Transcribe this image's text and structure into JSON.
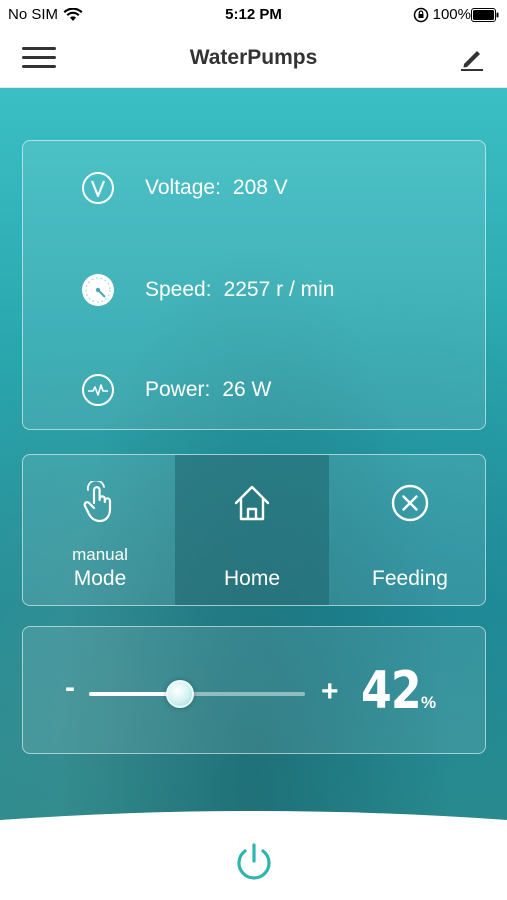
{
  "status_bar": {
    "carrier": "No SIM",
    "time": "5:12 PM",
    "battery": "100%"
  },
  "navbar": {
    "title": "WaterPumps",
    "menu_icon": "hamburger-menu-icon",
    "edit_icon": "pencil-icon"
  },
  "stats": [
    {
      "icon": "voltage-icon",
      "label": "Voltage:",
      "value": "208 V"
    },
    {
      "icon": "speedometer-icon",
      "label": "Speed:",
      "value": "2257 r / min"
    },
    {
      "icon": "power-wave-icon",
      "label": "Power:",
      "value": "26 W"
    }
  ],
  "modes": [
    {
      "icon": "hand-pointer-icon",
      "sub": "manual",
      "label": "Mode",
      "active": false
    },
    {
      "icon": "home-icon",
      "sub": "",
      "label": "Home",
      "active": true
    },
    {
      "icon": "close-circle-icon",
      "sub": "",
      "label": "Feeding",
      "active": false
    }
  ],
  "speed_control": {
    "minus": "-",
    "plus": "+",
    "percent": 42,
    "percent_text": "42",
    "percent_symbol": "%"
  },
  "colors": {
    "accent": "#2aa9a8",
    "power_button": "#2fb5ad"
  },
  "power_icon": "power-icon"
}
